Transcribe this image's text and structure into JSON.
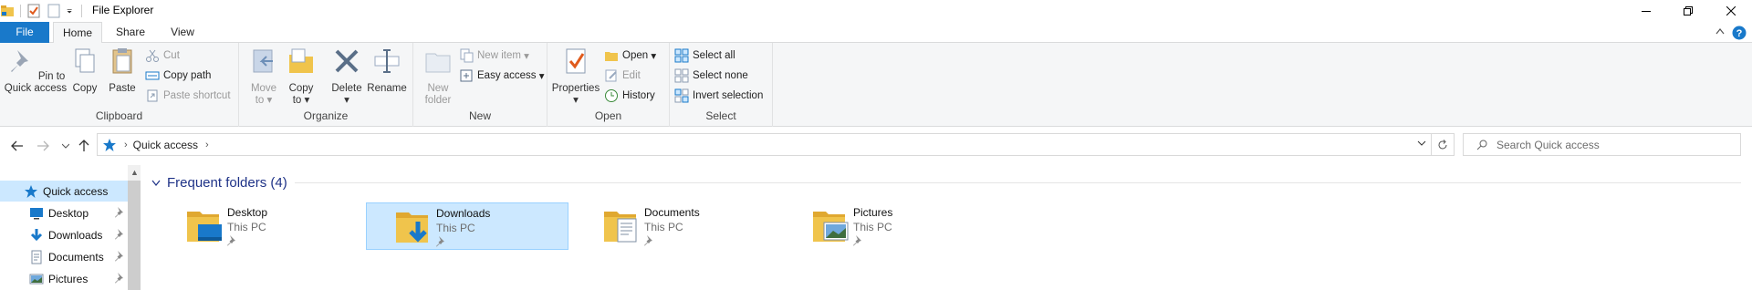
{
  "window": {
    "title": "File Explorer",
    "controls": [
      "minimize",
      "maximize",
      "close"
    ]
  },
  "ribbon_tabs": {
    "file": "File",
    "home": "Home",
    "share": "Share",
    "view": "View"
  },
  "clipboard": {
    "label": "Clipboard",
    "pin": "Pin to Quick access",
    "copy": "Copy",
    "paste": "Paste",
    "cut": "Cut",
    "copy_path": "Copy path",
    "paste_shortcut": "Paste shortcut"
  },
  "organize": {
    "label": "Organize",
    "move_to": "Move to",
    "copy_to": "Copy to",
    "delete": "Delete",
    "rename": "Rename"
  },
  "new": {
    "label": "New",
    "new_folder": "New folder",
    "new_item": "New item",
    "easy_access": "Easy access"
  },
  "open": {
    "label": "Open",
    "properties": "Properties",
    "open": "Open",
    "edit": "Edit",
    "history": "History"
  },
  "select": {
    "label": "Select",
    "select_all": "Select all",
    "select_none": "Select none",
    "invert": "Invert selection"
  },
  "address": {
    "location": "Quick access",
    "search_placeholder": "Search Quick access"
  },
  "nav_pane": {
    "quick_access": "Quick access",
    "items": [
      {
        "label": "Desktop",
        "icon": "desktop-icon"
      },
      {
        "label": "Downloads",
        "icon": "downloads-icon"
      },
      {
        "label": "Documents",
        "icon": "documents-icon"
      },
      {
        "label": "Pictures",
        "icon": "pictures-icon"
      }
    ]
  },
  "content": {
    "section_title": "Frequent folders (4)",
    "folders": [
      {
        "name": "Desktop",
        "location": "This PC",
        "selected": false
      },
      {
        "name": "Downloads",
        "location": "This PC",
        "selected": true
      },
      {
        "name": "Documents",
        "location": "This PC",
        "selected": false
      },
      {
        "name": "Pictures",
        "location": "This PC",
        "selected": false
      }
    ]
  },
  "colors": {
    "accent": "#1979ca",
    "selection": "#cce8ff",
    "folder": "#f0c44c",
    "section_head": "#1e3287"
  }
}
